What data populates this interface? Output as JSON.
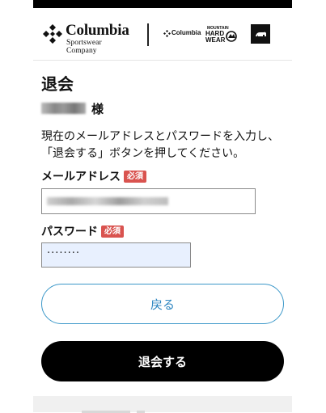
{
  "header": {
    "brand_name": "Columbia",
    "brand_sub": "Sportswear Company",
    "mini_brand": "Columbia",
    "mhw_lines": [
      "MOUNTAIN",
      "HARD",
      "WEAR"
    ]
  },
  "page": {
    "title": "退会",
    "honorific": "様",
    "instructions": [
      "現在のメールアドレスとパスワードを入力し、",
      "「退会する」ボタンを押してください。"
    ]
  },
  "form": {
    "email_label": "メールアドレス",
    "password_label": "パスワード",
    "required_badge": "必須",
    "password_value": "········"
  },
  "buttons": {
    "back": "戻る",
    "withdraw": "退会する"
  },
  "colors": {
    "required": "#d9534f",
    "back_border": "#3c98c9",
    "withdraw_bg": "#000000",
    "autofill_bg": "#e8f0fe"
  }
}
